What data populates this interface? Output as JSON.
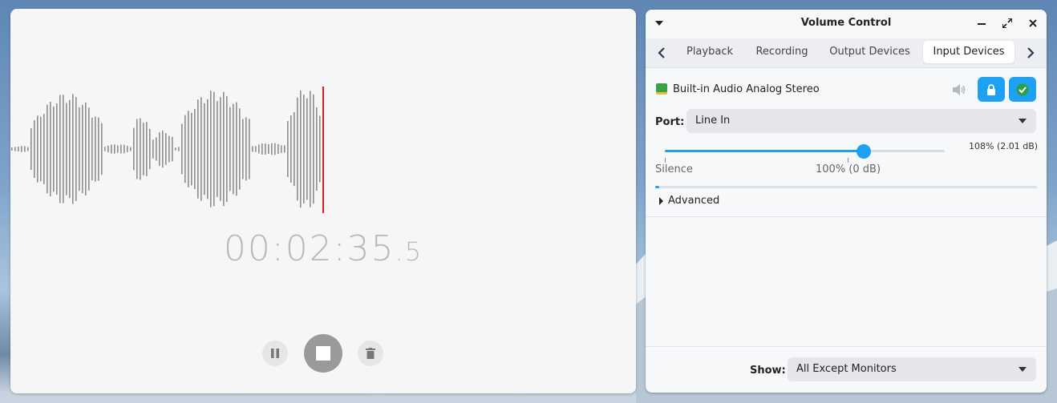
{
  "recorder": {
    "timer_main": "00:02:35",
    "timer_fraction": ".5",
    "controls": {
      "pause_icon": "pause-icon",
      "stop_icon": "stop-icon",
      "delete_icon": "trash-icon"
    }
  },
  "volume_control": {
    "title": "Volume Control",
    "window_buttons": [
      "minimize-icon",
      "maximize-icon",
      "close-icon"
    ],
    "tabs": [
      {
        "label": "Playback",
        "active": false
      },
      {
        "label": "Recording",
        "active": false
      },
      {
        "label": "Output Devices",
        "active": false
      },
      {
        "label": "Input Devices",
        "active": true
      }
    ],
    "device": {
      "name": "Built-in Audio Analog Stereo",
      "port_label": "Port:",
      "port_value": "Line In",
      "volume_percent_label": "108% (2.01 dB)",
      "volume_fraction": 0.71,
      "level_fraction": 0.01,
      "scale_min_label": "Silence",
      "scale_mid_label": "100% (0 dB)",
      "advanced_label": "Advanced",
      "lock_icon": "lock-icon",
      "default_icon": "check-icon",
      "mute_icon": "speaker-icon"
    },
    "footer": {
      "show_label": "Show:",
      "show_value": "All Except Monitors"
    },
    "colors": {
      "accent": "#1da1f2",
      "recorder_bg": "#f6f6f6",
      "playhead": "#e01b24"
    }
  }
}
